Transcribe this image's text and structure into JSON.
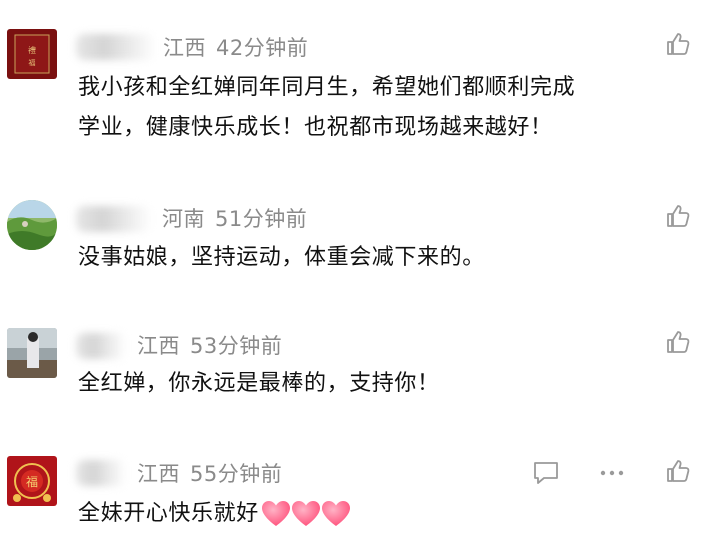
{
  "comments": [
    {
      "region": "江西",
      "time": "42分钟前",
      "text_lines": [
        "我小孩和全红婵同年同月生，希望她们都顺利完成",
        "学业，健康快乐成长！也祝都市现场越来越好！"
      ],
      "icon": "thumb-up-icon"
    },
    {
      "region": "河南",
      "time": "51分钟前",
      "text_lines": [
        "没事姑娘，坚持运动，体重会减下来的。"
      ],
      "icon": "thumb-up-icon"
    },
    {
      "region": "江西",
      "time": "53分钟前",
      "text_lines": [
        "全红婵，你永远是最棒的，支持你！"
      ],
      "icon": "thumb-up-icon"
    },
    {
      "region": "江西",
      "time": "55分钟前",
      "text_lines": [
        "全妹开心快乐就好"
      ],
      "emoji": [
        "heart-emoji",
        "heart-emoji",
        "heart-emoji"
      ],
      "icons": [
        "reply-icon",
        "more-icon",
        "thumb-up-icon"
      ]
    }
  ],
  "colors": {
    "meta": "#8a8a8a",
    "text": "#111111",
    "icon": "#9a9a9a",
    "heart": "#ff4f7a"
  }
}
